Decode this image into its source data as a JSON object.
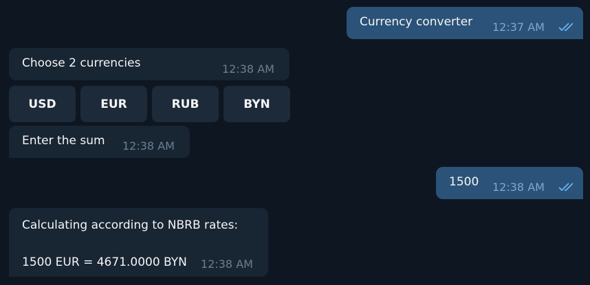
{
  "messages": [
    {
      "direction": "outgoing",
      "text": "Currency converter",
      "time": "12:37 AM",
      "status": "read-double-check-icon"
    },
    {
      "direction": "incoming",
      "text": "Choose 2 currencies",
      "time": "12:38 AM"
    },
    {
      "direction": "incoming",
      "text": "Enter the sum",
      "time": "12:38 AM"
    },
    {
      "direction": "outgoing",
      "text": "1500",
      "time": "12:38 AM",
      "status": "read-double-check-icon"
    },
    {
      "direction": "incoming",
      "text": "Calculating according to NBRB rates:\n\n1500 EUR = 4671.0000 BYN",
      "time": "12:38 AM"
    }
  ],
  "keyboard": [
    "USD",
    "EUR",
    "RUB",
    "BYN"
  ],
  "colors": {
    "background": "#0e1621",
    "incoming": "#182533",
    "outgoing": "#2b5278",
    "check": "#6ab3f3"
  }
}
